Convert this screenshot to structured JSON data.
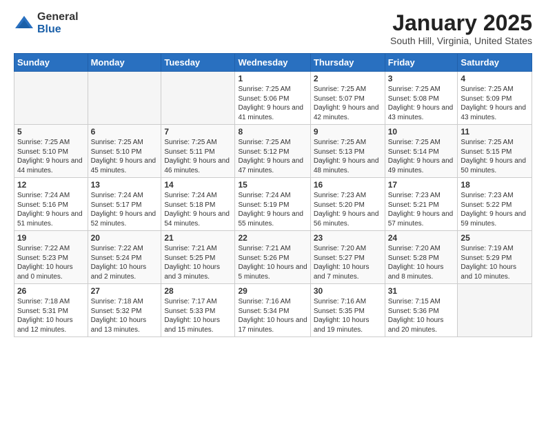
{
  "logo": {
    "general": "General",
    "blue": "Blue"
  },
  "header": {
    "month": "January 2025",
    "location": "South Hill, Virginia, United States"
  },
  "weekdays": [
    "Sunday",
    "Monday",
    "Tuesday",
    "Wednesday",
    "Thursday",
    "Friday",
    "Saturday"
  ],
  "weeks": [
    [
      {
        "day": "",
        "info": ""
      },
      {
        "day": "",
        "info": ""
      },
      {
        "day": "",
        "info": ""
      },
      {
        "day": "1",
        "info": "Sunrise: 7:25 AM\nSunset: 5:06 PM\nDaylight: 9 hours and 41 minutes."
      },
      {
        "day": "2",
        "info": "Sunrise: 7:25 AM\nSunset: 5:07 PM\nDaylight: 9 hours and 42 minutes."
      },
      {
        "day": "3",
        "info": "Sunrise: 7:25 AM\nSunset: 5:08 PM\nDaylight: 9 hours and 43 minutes."
      },
      {
        "day": "4",
        "info": "Sunrise: 7:25 AM\nSunset: 5:09 PM\nDaylight: 9 hours and 43 minutes."
      }
    ],
    [
      {
        "day": "5",
        "info": "Sunrise: 7:25 AM\nSunset: 5:10 PM\nDaylight: 9 hours and 44 minutes."
      },
      {
        "day": "6",
        "info": "Sunrise: 7:25 AM\nSunset: 5:10 PM\nDaylight: 9 hours and 45 minutes."
      },
      {
        "day": "7",
        "info": "Sunrise: 7:25 AM\nSunset: 5:11 PM\nDaylight: 9 hours and 46 minutes."
      },
      {
        "day": "8",
        "info": "Sunrise: 7:25 AM\nSunset: 5:12 PM\nDaylight: 9 hours and 47 minutes."
      },
      {
        "day": "9",
        "info": "Sunrise: 7:25 AM\nSunset: 5:13 PM\nDaylight: 9 hours and 48 minutes."
      },
      {
        "day": "10",
        "info": "Sunrise: 7:25 AM\nSunset: 5:14 PM\nDaylight: 9 hours and 49 minutes."
      },
      {
        "day": "11",
        "info": "Sunrise: 7:25 AM\nSunset: 5:15 PM\nDaylight: 9 hours and 50 minutes."
      }
    ],
    [
      {
        "day": "12",
        "info": "Sunrise: 7:24 AM\nSunset: 5:16 PM\nDaylight: 9 hours and 51 minutes."
      },
      {
        "day": "13",
        "info": "Sunrise: 7:24 AM\nSunset: 5:17 PM\nDaylight: 9 hours and 52 minutes."
      },
      {
        "day": "14",
        "info": "Sunrise: 7:24 AM\nSunset: 5:18 PM\nDaylight: 9 hours and 54 minutes."
      },
      {
        "day": "15",
        "info": "Sunrise: 7:24 AM\nSunset: 5:19 PM\nDaylight: 9 hours and 55 minutes."
      },
      {
        "day": "16",
        "info": "Sunrise: 7:23 AM\nSunset: 5:20 PM\nDaylight: 9 hours and 56 minutes."
      },
      {
        "day": "17",
        "info": "Sunrise: 7:23 AM\nSunset: 5:21 PM\nDaylight: 9 hours and 57 minutes."
      },
      {
        "day": "18",
        "info": "Sunrise: 7:23 AM\nSunset: 5:22 PM\nDaylight: 9 hours and 59 minutes."
      }
    ],
    [
      {
        "day": "19",
        "info": "Sunrise: 7:22 AM\nSunset: 5:23 PM\nDaylight: 10 hours and 0 minutes."
      },
      {
        "day": "20",
        "info": "Sunrise: 7:22 AM\nSunset: 5:24 PM\nDaylight: 10 hours and 2 minutes."
      },
      {
        "day": "21",
        "info": "Sunrise: 7:21 AM\nSunset: 5:25 PM\nDaylight: 10 hours and 3 minutes."
      },
      {
        "day": "22",
        "info": "Sunrise: 7:21 AM\nSunset: 5:26 PM\nDaylight: 10 hours and 5 minutes."
      },
      {
        "day": "23",
        "info": "Sunrise: 7:20 AM\nSunset: 5:27 PM\nDaylight: 10 hours and 7 minutes."
      },
      {
        "day": "24",
        "info": "Sunrise: 7:20 AM\nSunset: 5:28 PM\nDaylight: 10 hours and 8 minutes."
      },
      {
        "day": "25",
        "info": "Sunrise: 7:19 AM\nSunset: 5:29 PM\nDaylight: 10 hours and 10 minutes."
      }
    ],
    [
      {
        "day": "26",
        "info": "Sunrise: 7:18 AM\nSunset: 5:31 PM\nDaylight: 10 hours and 12 minutes."
      },
      {
        "day": "27",
        "info": "Sunrise: 7:18 AM\nSunset: 5:32 PM\nDaylight: 10 hours and 13 minutes."
      },
      {
        "day": "28",
        "info": "Sunrise: 7:17 AM\nSunset: 5:33 PM\nDaylight: 10 hours and 15 minutes."
      },
      {
        "day": "29",
        "info": "Sunrise: 7:16 AM\nSunset: 5:34 PM\nDaylight: 10 hours and 17 minutes."
      },
      {
        "day": "30",
        "info": "Sunrise: 7:16 AM\nSunset: 5:35 PM\nDaylight: 10 hours and 19 minutes."
      },
      {
        "day": "31",
        "info": "Sunrise: 7:15 AM\nSunset: 5:36 PM\nDaylight: 10 hours and 20 minutes."
      },
      {
        "day": "",
        "info": ""
      }
    ]
  ]
}
